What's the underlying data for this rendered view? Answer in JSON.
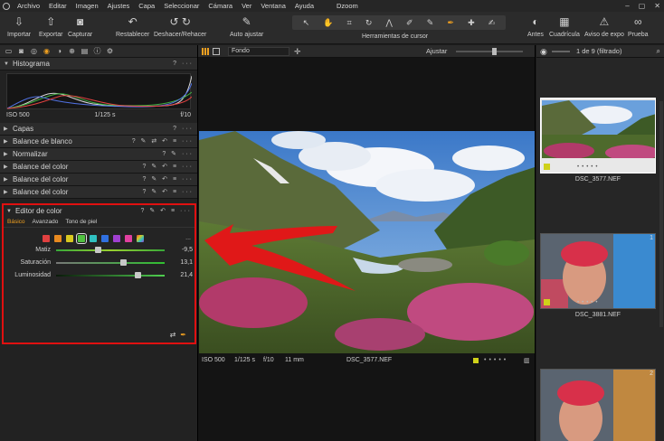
{
  "menubar": {
    "items": [
      "Archivo",
      "Editar",
      "Imagen",
      "Ajustes",
      "Capa",
      "Seleccionar",
      "Cámara",
      "Ver",
      "Ventana",
      "Ayuda"
    ],
    "title": "Dzoom"
  },
  "toolbar": {
    "importar": "Importar",
    "exportar": "Exportar",
    "capturar": "Capturar",
    "restablecer": "Restablecer",
    "deshacer": "Deshacer/Rehacer",
    "auto": "Auto ajustar",
    "cursor_label": "Herramientas de cursor",
    "antes": "Antes",
    "cuadricula": "Cuadrícula",
    "aviso": "Aviso de expo",
    "prueba": "Prueba"
  },
  "left": {
    "histograma": "Histograma",
    "histo_iso": "ISO 500",
    "histo_speed": "1/125 s",
    "histo_f": "f/10",
    "sections": [
      "Capas",
      "Balance de blanco",
      "Normalizar",
      "Balance del color",
      "Balance del color",
      "Balance del color"
    ],
    "color_editor": {
      "title": "Editor de color",
      "tabs": [
        "Básico",
        "Avanzado",
        "Tono de piel"
      ],
      "swatches": [
        "#e04040",
        "#e88a20",
        "#d8c820",
        "#50c040",
        "#30c0c0",
        "#3070e0",
        "#a040d0",
        "#e040a0"
      ],
      "selected_swatch": 3,
      "more": "...",
      "sliders": [
        {
          "label": "Matiz",
          "value": "-9,5",
          "pos": 0.38
        },
        {
          "label": "Saturación",
          "value": "13,1",
          "pos": 0.62
        },
        {
          "label": "Luminosidad",
          "value": "21,4",
          "pos": 0.75
        }
      ]
    }
  },
  "viewer": {
    "fondo": "Fondo",
    "ajustar": "Ajustar",
    "iso": "ISO 500",
    "speed": "1/125 s",
    "aperture": "f/10",
    "focal": "11 mm",
    "filename": "DSC_3577.NEF"
  },
  "browser": {
    "count": "1 de 9 (filtrado)",
    "thumbs": [
      {
        "name": "DSC_3577.NEF",
        "selected": true
      },
      {
        "name": "DSC_3881.NEF",
        "selected": false,
        "badge": "1"
      },
      {
        "name": "",
        "selected": false,
        "badge": "2"
      }
    ]
  }
}
